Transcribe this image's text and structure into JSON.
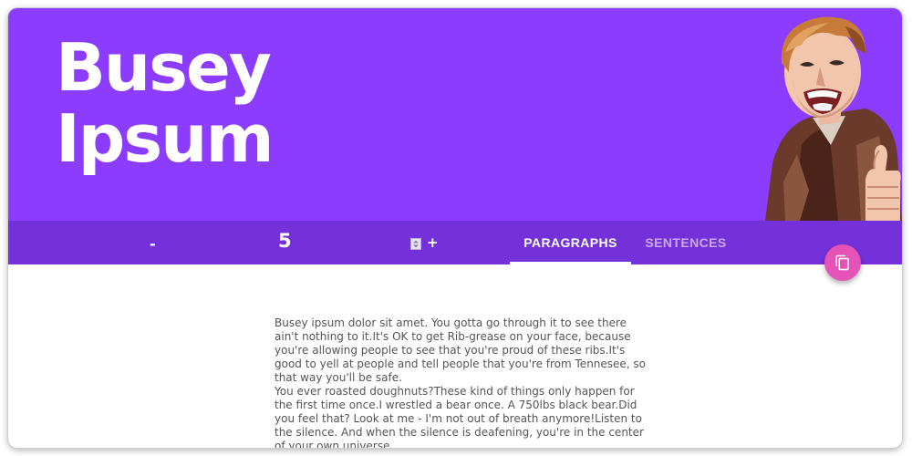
{
  "header": {
    "title_line1": "Busey",
    "title_line2": "Ipsum",
    "background": "#8c3cff",
    "portrait": "laughing-man-thumbs-up-illustration"
  },
  "toolbar": {
    "background": "#7431d9",
    "decrement_label": "-",
    "count": "5",
    "increment_label": "+",
    "spinner_icon": "spinner-icon",
    "tabs": [
      {
        "label": "PARAGRAPHS",
        "active": true
      },
      {
        "label": "SENTENCES",
        "active": false
      }
    ]
  },
  "copy_button": {
    "icon": "copy-icon",
    "color": "#e553b9"
  },
  "content": {
    "paragraphs": [
      "Busey ipsum dolor sit amet. You gotta go through it to see there ain't nothing to it.It's OK to get Rib-grease on your face, because you're allowing people to see that you're proud of these ribs.It's good to yell at people and tell people that you're from Tennesee, so that way you'll be safe.",
      "You ever roasted doughnuts?These kind of things only happen for the first time once.I wrestled a bear once. A 750lbs black bear.Did you feel that? Look at me - I'm not out of breath anymore!Listen to the silence. And when the silence is deafening, you're in the center of your own universe."
    ]
  }
}
